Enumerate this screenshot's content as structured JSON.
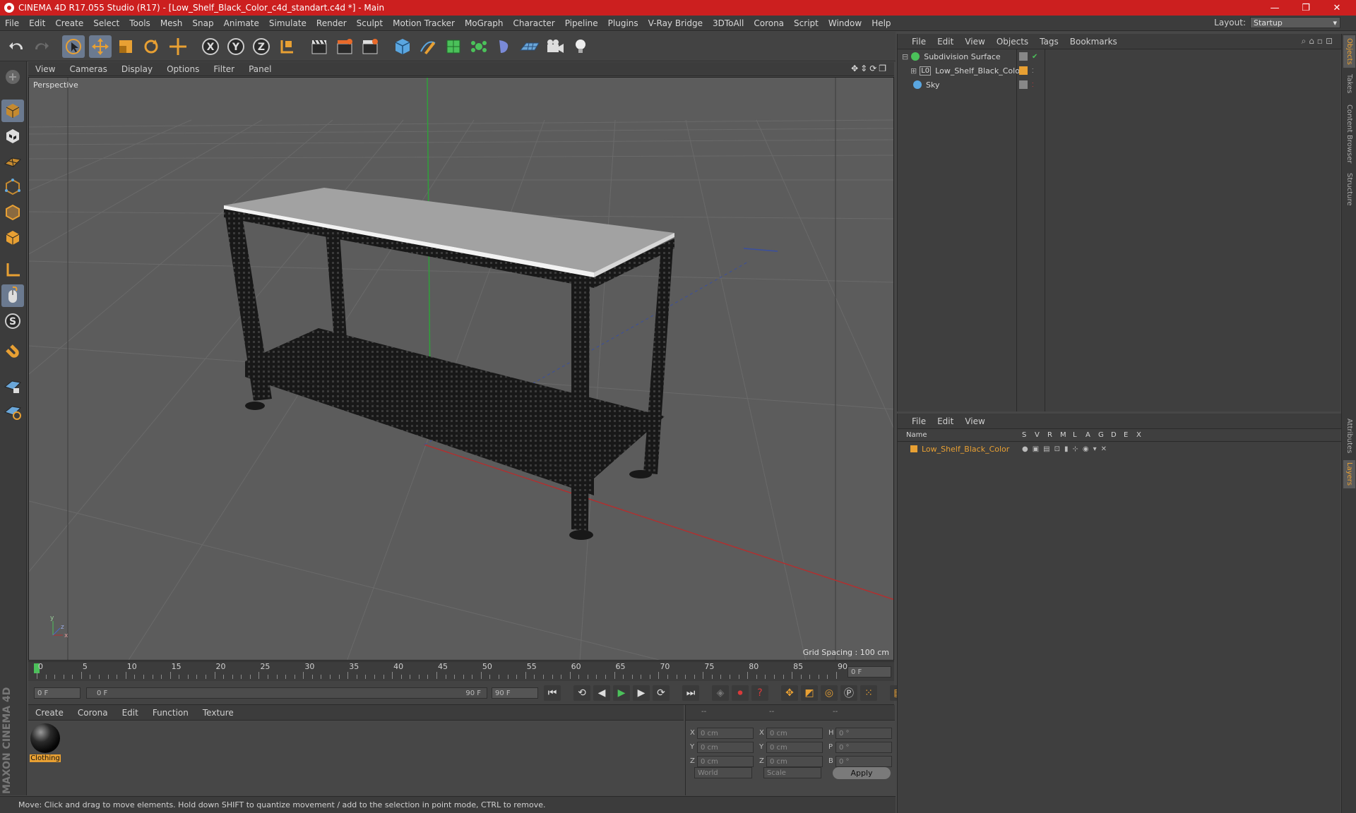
{
  "window": {
    "title": "CINEMA 4D R17.055 Studio (R17) - [Low_Shelf_Black_Color_c4d_standart.c4d *] - Main",
    "minimize": "—",
    "restore": "❐",
    "close": "✕"
  },
  "menu": [
    "File",
    "Edit",
    "Create",
    "Select",
    "Tools",
    "Mesh",
    "Snap",
    "Animate",
    "Simulate",
    "Render",
    "Sculpt",
    "Motion Tracker",
    "MoGraph",
    "Character",
    "Pipeline",
    "Plugins",
    "V-Ray Bridge",
    "3DToAll",
    "Corona",
    "Script",
    "Window",
    "Help"
  ],
  "layout": {
    "label": "Layout:",
    "value": "Startup"
  },
  "viewport": {
    "menu": [
      "View",
      "Cameras",
      "Display",
      "Options",
      "Filter",
      "Panel"
    ],
    "label": "Perspective",
    "grid_spacing": "Grid Spacing : 100 cm"
  },
  "timeline": {
    "ticks": [
      "0",
      "5",
      "10",
      "15",
      "20",
      "25",
      "30",
      "35",
      "40",
      "45",
      "50",
      "55",
      "60",
      "65",
      "70",
      "75",
      "80",
      "85",
      "90"
    ],
    "current_frame": "0 F"
  },
  "transport": {
    "start": "0 F",
    "range_start": "0 F",
    "range_end": "90 F",
    "end": "90 F"
  },
  "material_manager": {
    "menu": [
      "Create",
      "Corona",
      "Edit",
      "Function",
      "Texture"
    ],
    "materials": [
      {
        "name": "Clothing"
      }
    ]
  },
  "coordinates": {
    "headers": [
      "--",
      "--",
      "--"
    ],
    "rows": [
      {
        "a": "X",
        "av": "0 cm",
        "b": "X",
        "bv": "0 cm",
        "c": "H",
        "cv": "0 °"
      },
      {
        "a": "Y",
        "av": "0 cm",
        "b": "Y",
        "bv": "0 cm",
        "c": "P",
        "cv": "0 °"
      },
      {
        "a": "Z",
        "av": "0 cm",
        "b": "Z",
        "bv": "0 cm",
        "c": "B",
        "cv": "0 °"
      }
    ],
    "mode": "World",
    "scale": "Scale",
    "apply": "Apply"
  },
  "status": "Move: Click and drag to move elements. Hold down SHIFT to quantize movement / add to the selection in point mode, CTRL to remove.",
  "object_manager": {
    "menu": [
      "File",
      "Edit",
      "View",
      "Objects",
      "Tags",
      "Bookmarks"
    ],
    "objects": [
      {
        "name": "Subdivision Surface"
      },
      {
        "name": "Low_Shelf_Black_Color"
      },
      {
        "name": "Sky"
      }
    ]
  },
  "layer_manager": {
    "menu": [
      "File",
      "Edit",
      "View"
    ],
    "columns": [
      "Name",
      "S",
      "V",
      "R",
      "M",
      "L",
      "A",
      "G",
      "D",
      "E",
      "X"
    ],
    "layers": [
      {
        "name": "Low_Shelf_Black_Color"
      }
    ]
  },
  "right_tabs": [
    "Objects",
    "Takes",
    "Content Browser",
    "Structure",
    "Attributes",
    "Layers"
  ],
  "branding": "MAXON CINEMA 4D",
  "colors": {
    "accent": "#e8a033",
    "title_bar": "#cc1f1f",
    "selected_tool": "#6b7a90"
  }
}
